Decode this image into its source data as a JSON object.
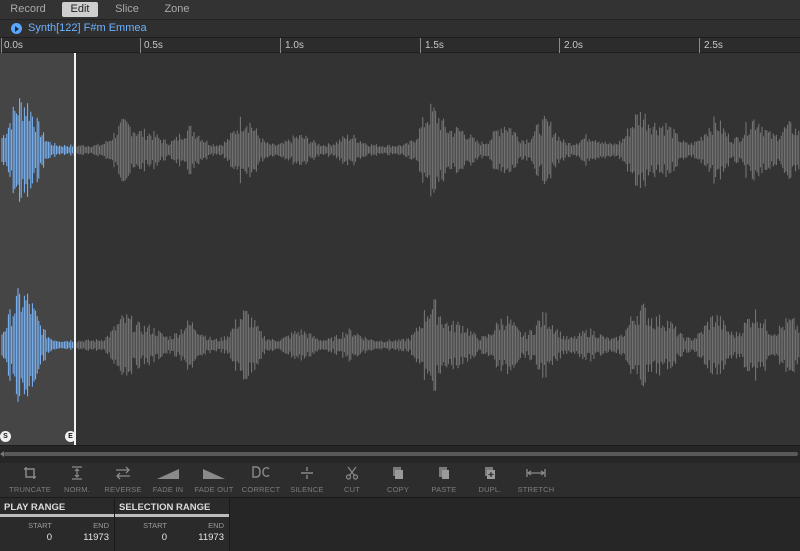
{
  "tabs": [
    {
      "label": "Record",
      "active": false
    },
    {
      "label": "Edit",
      "active": true
    },
    {
      "label": "Slice",
      "active": false
    },
    {
      "label": "Zone",
      "active": false
    }
  ],
  "sample": {
    "name": "Synth[122] F#m Emmea",
    "icon": "play-circle-icon"
  },
  "timeline": {
    "labels": [
      "0.0s",
      "0.5s",
      "1.0s",
      "1.5s",
      "2.0s",
      "2.5s"
    ]
  },
  "markers": {
    "start": "S",
    "end": "E"
  },
  "toolbar": [
    {
      "label": "TRUNCATE",
      "icon": "truncate-icon"
    },
    {
      "label": "NORM.",
      "icon": "normalize-icon"
    },
    {
      "label": "REVERSE",
      "icon": "reverse-icon"
    },
    {
      "label": "FADE IN",
      "icon": "fade-in-icon"
    },
    {
      "label": "FADE OUT",
      "icon": "fade-out-icon"
    },
    {
      "label": "CORRECT",
      "icon": "dc-correct-icon"
    },
    {
      "label": "SILENCE",
      "icon": "silence-icon"
    },
    {
      "label": "CUT",
      "icon": "scissors-icon"
    },
    {
      "label": "COPY",
      "icon": "copy-icon"
    },
    {
      "label": "PASTE",
      "icon": "paste-icon"
    },
    {
      "label": "DUPL.",
      "icon": "duplicate-icon"
    },
    {
      "label": "STRETCH",
      "icon": "stretch-icon"
    }
  ],
  "play_range": {
    "title": "PLAY RANGE",
    "start_label": "START",
    "end_label": "END",
    "start": "0",
    "end": "11973"
  },
  "selection_range": {
    "title": "SELECTION RANGE",
    "start_label": "START",
    "end_label": "END",
    "start": "0",
    "end": "11973"
  },
  "colors": {
    "selected_wave": "#7ab8ff",
    "wave": "#7a7a7a",
    "accent": "#5aa7ff"
  }
}
